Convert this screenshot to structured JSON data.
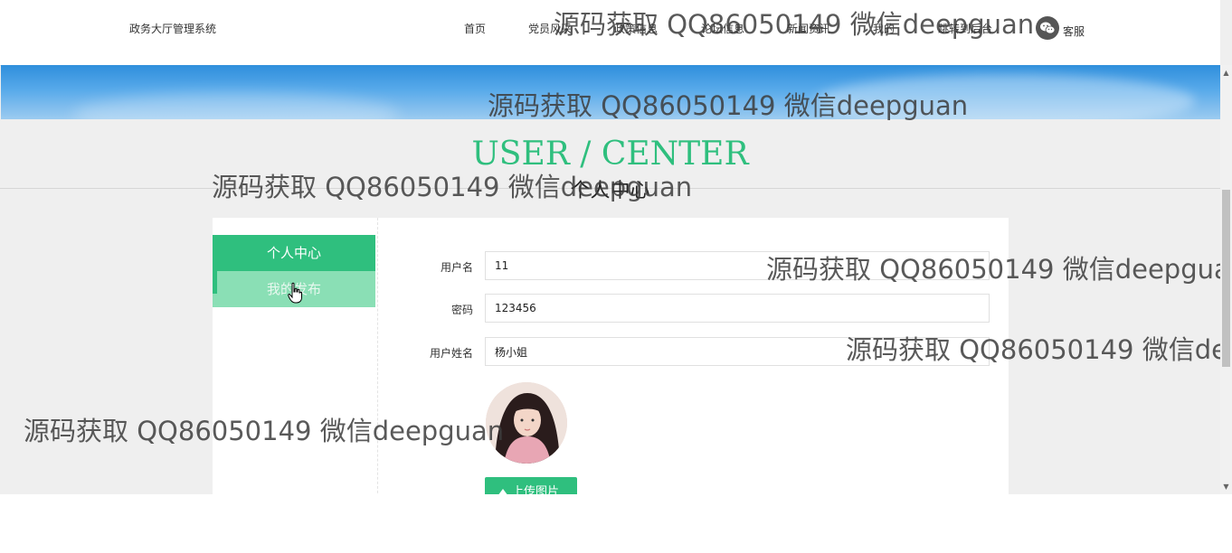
{
  "header": {
    "site_title": "政务大厅管理系统",
    "nav": [
      {
        "label": "首页"
      },
      {
        "label": "党员风采"
      },
      {
        "label": "政策信息"
      },
      {
        "label": "论坛信息"
      },
      {
        "label": "新闻资讯"
      },
      {
        "label": "我的"
      },
      {
        "label": "跳转到后台"
      }
    ],
    "service_label": "客服",
    "service_icon": "wechat-icon"
  },
  "page": {
    "center_heading": "USER / CENTER",
    "section_title": "个人中心"
  },
  "sidebar": {
    "items": [
      {
        "label": "个人中心",
        "active": true
      },
      {
        "label": "我的发布",
        "active": false
      }
    ]
  },
  "form": {
    "username": {
      "label": "用户名",
      "value": "11"
    },
    "password": {
      "label": "密码",
      "value": "123456"
    },
    "realname": {
      "label": "用户姓名",
      "value": "杨小姐"
    },
    "upload_label": "上传图片",
    "upload_icon": "upload-icon"
  },
  "watermark": "源码获取 QQ86050149 微信deepguan",
  "colors": {
    "accent": "#2fbf7e",
    "accent_light": "#8adfb5",
    "banner": "#2f8fdc",
    "page_bg": "#efefef"
  }
}
